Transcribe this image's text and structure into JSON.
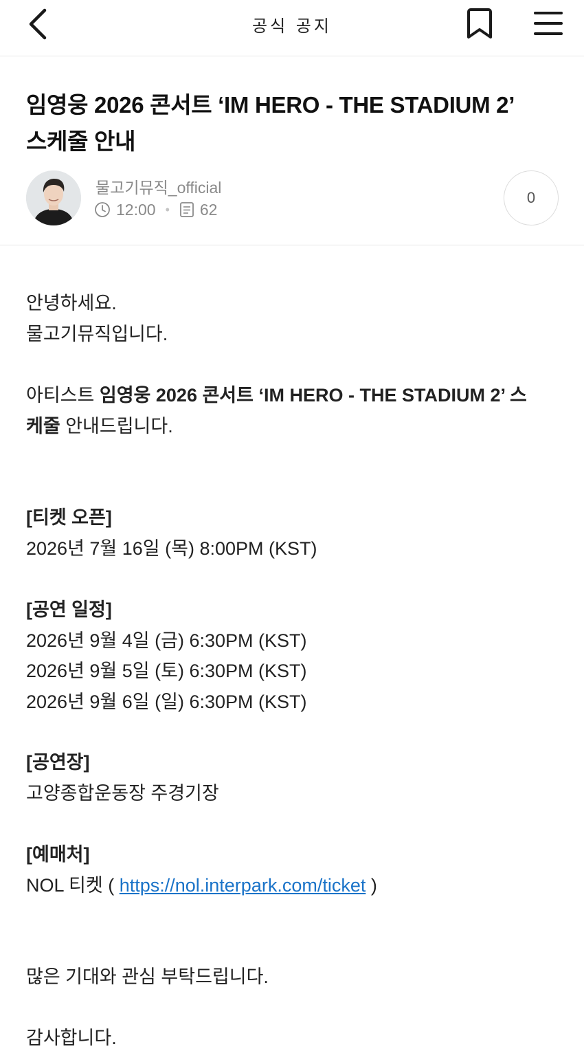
{
  "header": {
    "title": "공식 공지"
  },
  "post": {
    "title_line1": "임영웅 2026 콘서트 ‘IM HERO - THE STADIUM 2’",
    "title_line2": "스케줄 안내",
    "author": "물고기뮤직_official",
    "time": "12:00",
    "views": "62",
    "comment_count": "0"
  },
  "body": {
    "greeting": "안녕하세요.",
    "intro": "물고기뮤직입니다.",
    "announce_prefix": "아티스트 ",
    "announce_bold1": "임영웅 2026 콘서트 ‘IM HERO - THE STADIUM 2’ 스",
    "announce_bold2": "케줄",
    "announce_suffix": " 안내드립니다.",
    "ticket_open_heading": "[티켓 오픈]",
    "ticket_open_date": "2026년 7월 16일 (목) 8:00PM (KST)",
    "schedule_heading": "[공연 일정]",
    "schedule": [
      "2026년 9월 4일 (금) 6:30PM (KST)",
      "2026년 9월 5일 (토) 6:30PM (KST)",
      "2026년 9월 6일 (일) 6:30PM (KST)"
    ],
    "venue_heading": "[공연장]",
    "venue": "고양종합운동장 주경기장",
    "booking_heading": "[예매처]",
    "booking_prefix": "NOL 티켓 ( ",
    "booking_url": "https://nol.interpark.com/ticket",
    "booking_suffix": " )",
    "closing1": "많은 기대와 관심 부탁드립니다.",
    "closing2": "감사합니다."
  },
  "colors": {
    "link": "#1a73c8",
    "meta_text": "#8a8a8a"
  },
  "icons": [
    "back-icon",
    "bookmark-icon",
    "menu-icon",
    "clock-icon",
    "views-icon"
  ]
}
